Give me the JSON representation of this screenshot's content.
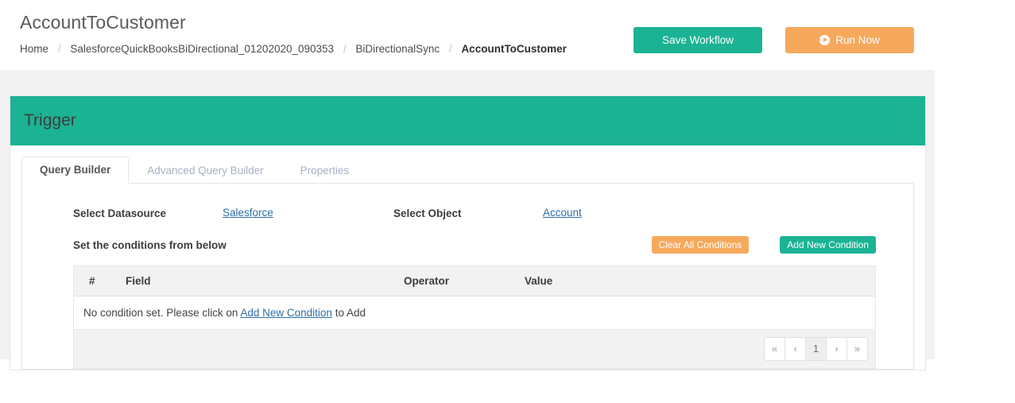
{
  "header": {
    "title": "AccountToCustomer",
    "breadcrumb": [
      {
        "label": "Home",
        "active": false
      },
      {
        "label": "SalesforceQuickBooksBiDirectional_01202020_090353",
        "active": false
      },
      {
        "label": "BiDirectionalSync",
        "active": false
      },
      {
        "label": "AccountToCustomer",
        "active": true
      }
    ],
    "separator": "/",
    "save_label": "Save Workflow",
    "run_label": "Run Now",
    "run_icon": "play-circle-icon"
  },
  "panel": {
    "title": "Trigger",
    "tabs": [
      {
        "label": "Query Builder",
        "active": true
      },
      {
        "label": "Advanced Query Builder",
        "active": false
      },
      {
        "label": "Properties",
        "active": false
      }
    ],
    "datasource": {
      "label": "Select Datasource",
      "value": "Salesforce"
    },
    "object": {
      "label": "Select Object",
      "value": "Account"
    },
    "conditions": {
      "title": "Set the conditions from below",
      "clear_label": "Clear All Conditions",
      "add_label": "Add New Condition",
      "columns": [
        "#",
        "Field",
        "Operator",
        "Value"
      ],
      "empty_prefix": "No condition set. Please click on ",
      "empty_link": "Add New Condition",
      "empty_suffix": " to Add",
      "rows": []
    },
    "pagination": {
      "first": "«",
      "prev": "‹",
      "pages": [
        "1"
      ],
      "current": "1",
      "next": "›",
      "last": "»"
    }
  },
  "colors": {
    "teal": "#1bb394",
    "orange": "#f6a95c",
    "link": "#2f6fa8",
    "band": "#f2f2f2"
  }
}
